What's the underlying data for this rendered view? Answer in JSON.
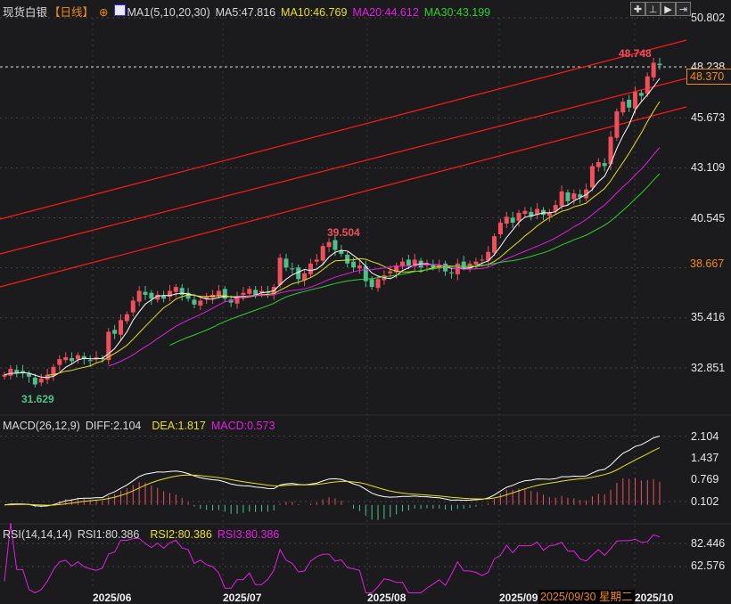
{
  "header": {
    "instrument": "现货白银",
    "period": "【日线】",
    "ma_title": "MA1(5,10,20,30)",
    "ma5": "MA5:47.816",
    "ma10": "MA10:46.769",
    "ma20": "MA20:44.612",
    "ma30": "MA30:43.199"
  },
  "toolbar": {
    "icons": [
      "crosshair-icon",
      "range-select-icon",
      "play-forward-icon",
      "jump-end-icon"
    ],
    "glyphs": [
      "✚",
      "⊥",
      "▶",
      "⇥"
    ]
  },
  "colors": {
    "up": "#f0505c",
    "down": "#4fbf8d",
    "ma5": "#ffffff",
    "ma10": "#e6e020",
    "ma20": "#e020e0",
    "ma30": "#30d030",
    "trend": "#ff1a1a",
    "accent": "#f08a1e"
  },
  "main_axis": {
    "ticks": [
      "50.802",
      "48.238",
      "45.673",
      "43.109",
      "40.545",
      "35.416",
      "32.851"
    ],
    "tick_values": [
      50.802,
      48.238,
      45.673,
      43.109,
      40.545,
      35.416,
      32.851
    ],
    "current_price": "48.370",
    "marker_price": "38.667",
    "high_label": "48.748",
    "mid_high_label": "39.504",
    "low_label": "31.629"
  },
  "macd": {
    "title": "MACD(26,12,9)",
    "diff": "DIFF:2.104",
    "dea": "DEA:1.817",
    "macd": "MACD:0.573",
    "ticks": [
      "2.104",
      "1.437",
      "0.769",
      "0.102"
    ]
  },
  "rsi": {
    "title": "RSI(14,14,14)",
    "rsi1": "RSI1:80.386",
    "rsi2": "RSI2:80.386",
    "rsi3": "RSI3:80.386",
    "ticks": [
      "82.446",
      "62.576"
    ]
  },
  "dates": {
    "jun": "2025/06",
    "jul": "2025/07",
    "aug": "2025/08",
    "sep": "2025/09",
    "oct": "2025/10",
    "crosshair": "2025/09/30 星期二"
  },
  "chart_data": {
    "type": "candlestick",
    "title": "现货白银 日线",
    "ylim": [
      31.0,
      51.5
    ],
    "closes": [
      32.5,
      32.8,
      32.6,
      32.6,
      32.4,
      32.0,
      32.3,
      32.5,
      32.9,
      33.3,
      33.4,
      33.2,
      33.5,
      33.3,
      33.2,
      33.4,
      33.3,
      34.7,
      34.6,
      35.3,
      35.6,
      36.3,
      36.8,
      36.6,
      36.4,
      36.6,
      36.4,
      36.8,
      37.0,
      36.6,
      36.4,
      36.1,
      36.3,
      36.5,
      36.6,
      36.8,
      36.4,
      36.2,
      36.5,
      36.7,
      36.9,
      36.6,
      36.8,
      36.7,
      37.0,
      38.5,
      38.0,
      37.9,
      37.4,
      37.7,
      38.2,
      38.4,
      39.1,
      39.3,
      38.9,
      38.7,
      38.2,
      38.0,
      38.1,
      37.3,
      37.0,
      37.4,
      37.6,
      37.8,
      38.1,
      38.3,
      38.1,
      38.4,
      38.0,
      38.2,
      38.0,
      38.1,
      37.8,
      37.7,
      38.2,
      38.0,
      38.2,
      38.3,
      38.4,
      38.8,
      39.6,
      40.3,
      40.6,
      40.3,
      40.8,
      40.9,
      40.6,
      41.0,
      40.7,
      40.8,
      41.2,
      41.9,
      41.4,
      41.8,
      41.6,
      42.0,
      43.2,
      43.4,
      43.2,
      44.7,
      46.0,
      46.5,
      46.2,
      47.0,
      46.8,
      47.8,
      48.5,
      48.37
    ],
    "moving_averages": [
      "MA5",
      "MA10",
      "MA20",
      "MA30"
    ]
  }
}
